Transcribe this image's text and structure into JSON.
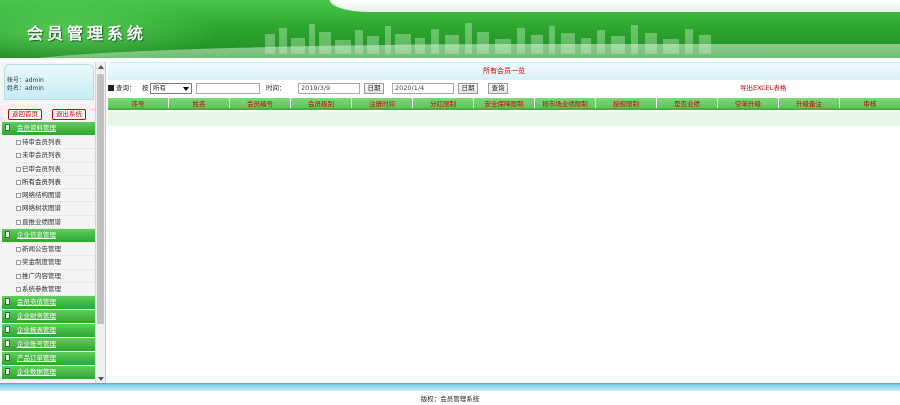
{
  "header": {
    "brand": "会员管理系统"
  },
  "user": {
    "account_line": "帐号：admin",
    "name_line": "姓名：admin"
  },
  "sidebar_buttons": {
    "home": "返回首页",
    "logout": "退出系统"
  },
  "menu": {
    "groups": [
      {
        "label": "会员资料管理",
        "items": [
          "待审会员列表",
          "未审会员列表",
          "已审会员列表",
          "所有会员列表",
          "网络结构图谱",
          "网络树状图谱",
          "直推业绩图谱"
        ]
      },
      {
        "label": "企业信息管理",
        "items": [
          "新闻公告管理",
          "奖金制度管理",
          "推广内容管理",
          "系统参数管理"
        ]
      },
      {
        "label": "会员充值管理",
        "items": []
      },
      {
        "label": "企业财务管理",
        "items": []
      },
      {
        "label": "企业报表管理",
        "items": []
      },
      {
        "label": "企业账号管理",
        "items": []
      },
      {
        "label": "产品订单管理",
        "items": []
      },
      {
        "label": "企业数据管理",
        "items": []
      }
    ]
  },
  "main": {
    "title": "所有会员一览",
    "query": {
      "label": "查询：",
      "by_label": "按",
      "select_value": "所有",
      "time_label": "时间：",
      "start_date": "2019/3/9",
      "date_btn1": "日期",
      "end_date": "2020/1/4",
      "date_btn2": "日期",
      "search_btn": "查询",
      "export": "导出EXCEL表格"
    },
    "columns": [
      "序号",
      "姓名",
      "会员编号",
      "会员级别",
      "注册时间",
      "分红限制",
      "安全保障限制",
      "按市场业绩限制",
      "授权限制",
      "是否业绩",
      "空单升级",
      "升级备注",
      "审核"
    ]
  },
  "footer": {
    "copyright": "版权：会员管理系统"
  }
}
